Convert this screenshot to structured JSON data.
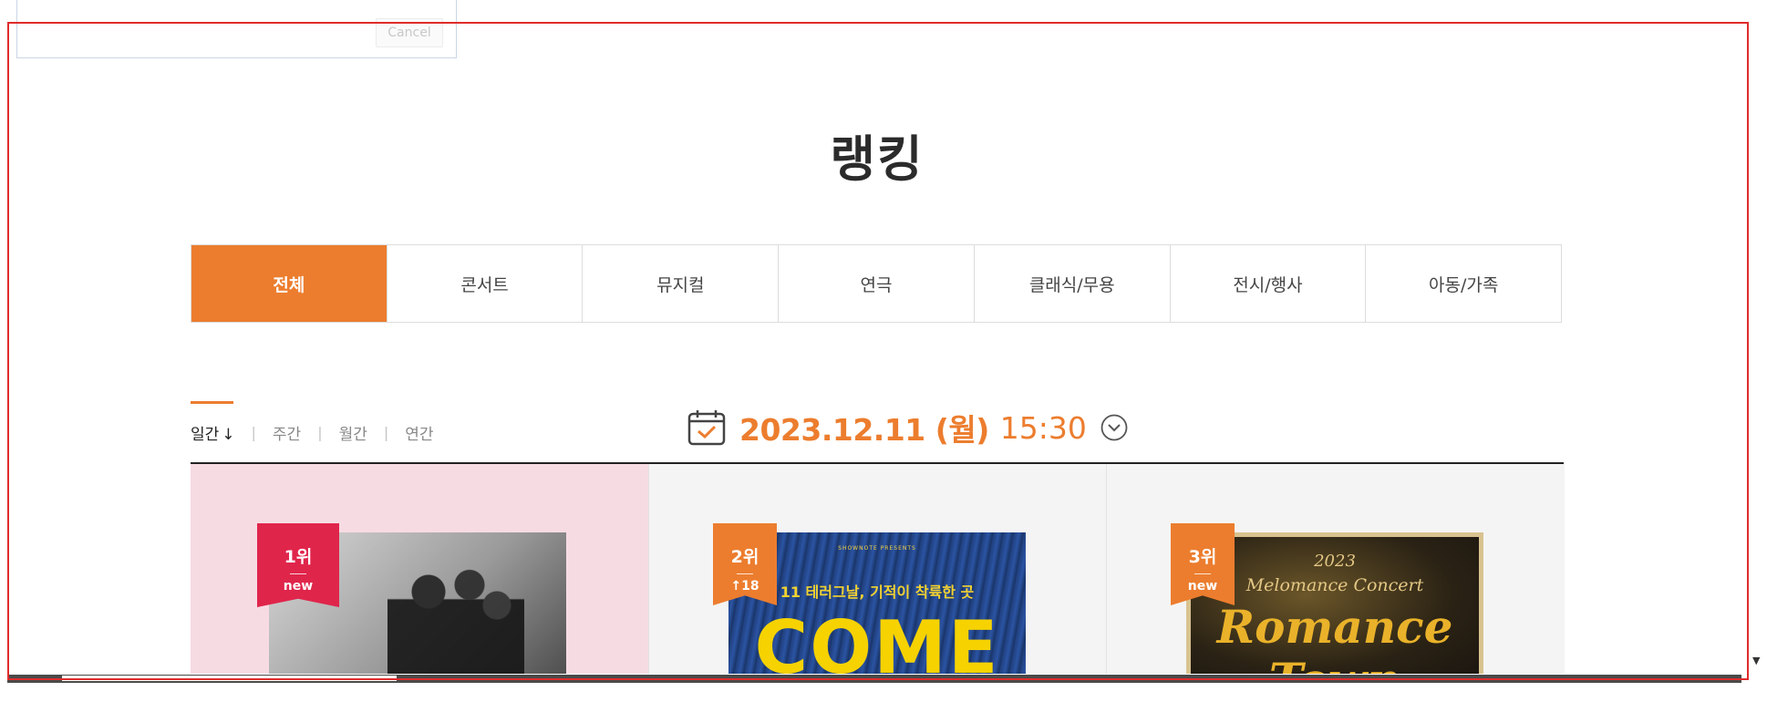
{
  "dialog": {
    "cancel_label": "Cancel"
  },
  "page_title": "랭킹",
  "categories": [
    {
      "label": "전체",
      "active": true
    },
    {
      "label": "콘서트",
      "active": false
    },
    {
      "label": "뮤지컬",
      "active": false
    },
    {
      "label": "연극",
      "active": false
    },
    {
      "label": "클래식/무용",
      "active": false
    },
    {
      "label": "전시/행사",
      "active": false
    },
    {
      "label": "아동/가족",
      "active": false
    }
  ],
  "periods": [
    {
      "label": "일간",
      "active": true
    },
    {
      "label": "주간",
      "active": false
    },
    {
      "label": "월간",
      "active": false
    },
    {
      "label": "연간",
      "active": false
    }
  ],
  "sort_arrow": "↓",
  "ranking_date": {
    "date": "2023.12.11 (월)",
    "time": "15:30",
    "icon": "calendar-icon",
    "toggle_icon": "chevron-down-circle-icon"
  },
  "items": [
    {
      "rank": "1위",
      "change": "new",
      "badge_color": "#e0254b",
      "card_bg": "#f7dbe3"
    },
    {
      "rank": "2위",
      "change": "↑18",
      "badge_color": "#ec7d2e",
      "card_bg": "#f4f4f4",
      "poster_text": {
        "presents": "SHOWNOTE PRESENTS",
        "subtitle": "11 테러그날, 기적이 착륙한 곳",
        "title": "COME"
      }
    },
    {
      "rank": "3위",
      "change": "new",
      "badge_color": "#ec7d2e",
      "card_bg": "#f4f4f4",
      "poster_text": {
        "year": "2023",
        "subtitle": "Melomance Concert",
        "title": "Romance Town"
      }
    }
  ],
  "colors": {
    "accent": "#ec7d2e",
    "rank1": "#e0254b",
    "frame": "#e02b2b"
  }
}
